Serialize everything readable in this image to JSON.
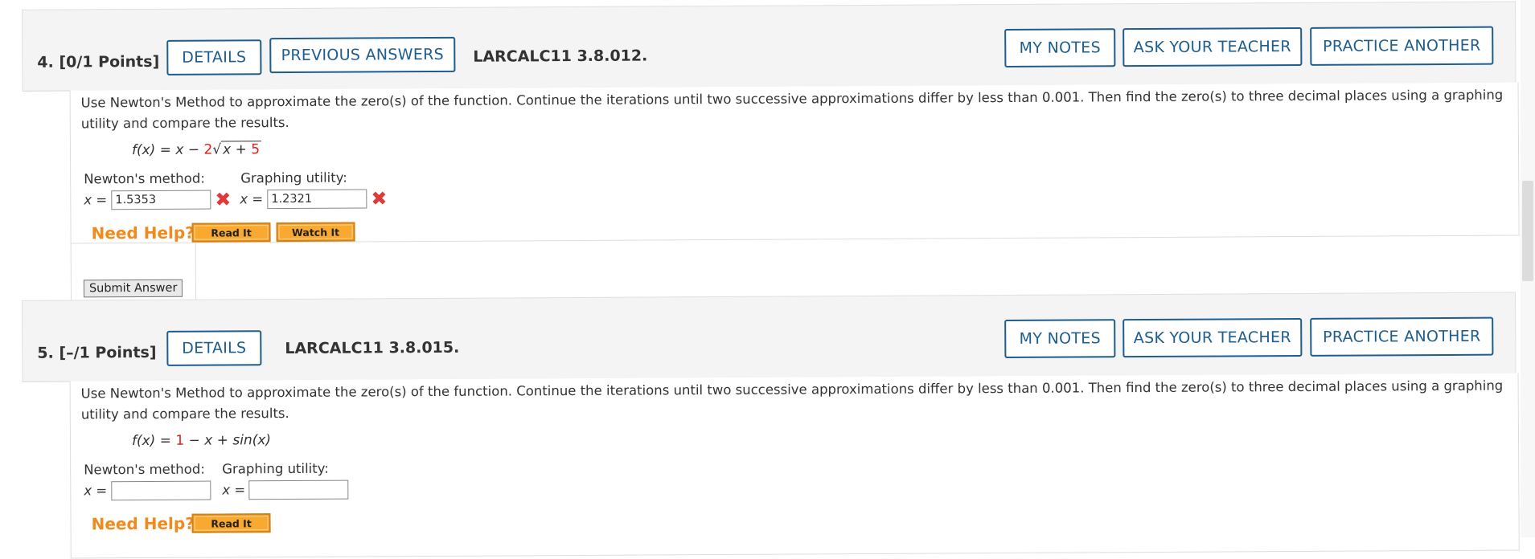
{
  "questions": [
    {
      "number": "4.",
      "points": "[0/1 Points]",
      "details_label": "DETAILS",
      "previous_answers_label": "PREVIOUS ANSWERS",
      "code": "LARCALC11 3.8.012.",
      "my_notes_label": "MY NOTES",
      "ask_teacher_label": "ASK YOUR TEACHER",
      "practice_label": "PRACTICE ANOTHER",
      "prompt": "Use Newton's Method to approximate the zero(s) of the function. Continue the iterations until two successive approximations differ by less than 0.001. Then find the zero(s) to three decimal places using a graphing utility and compare the results.",
      "function_lhs": "f(x) = x − ",
      "function_coef": "2",
      "function_radicand": "x + ",
      "function_const": "5",
      "newton_label": "Newton's method:",
      "graphing_label": "Graphing utility:",
      "x_eq": "x =",
      "newton_value": "1.5353",
      "graphing_value": "1.2321",
      "need_help": "Need Help?",
      "read_it": "Read It",
      "watch_it": "Watch It",
      "submit": "Submit Answer"
    },
    {
      "number": "5.",
      "points": "[–/1 Points]",
      "details_label": "DETAILS",
      "code": "LARCALC11 3.8.015.",
      "my_notes_label": "MY NOTES",
      "ask_teacher_label": "ASK YOUR TEACHER",
      "practice_label": "PRACTICE ANOTHER",
      "prompt": "Use Newton's Method to approximate the zero(s) of the function. Continue the iterations until two successive approximations differ by less than 0.001. Then find the zero(s) to three decimal places using a graphing utility and compare the results.",
      "function_lhs": "f(x) = ",
      "function_const": "1",
      "function_rest": " − x + sin(x)",
      "newton_label": "Newton's method:",
      "graphing_label": "Graphing utility:",
      "x_eq": "x =",
      "newton_value": "",
      "graphing_value": "",
      "need_help": "Need Help?",
      "read_it": "Read It"
    }
  ],
  "colors": {
    "accent": "#1d5d8f",
    "error": "#e0393a",
    "help": "#f08a1c",
    "highlight": "#e0201b"
  },
  "icons": {
    "incorrect": "x-mark-icon"
  }
}
